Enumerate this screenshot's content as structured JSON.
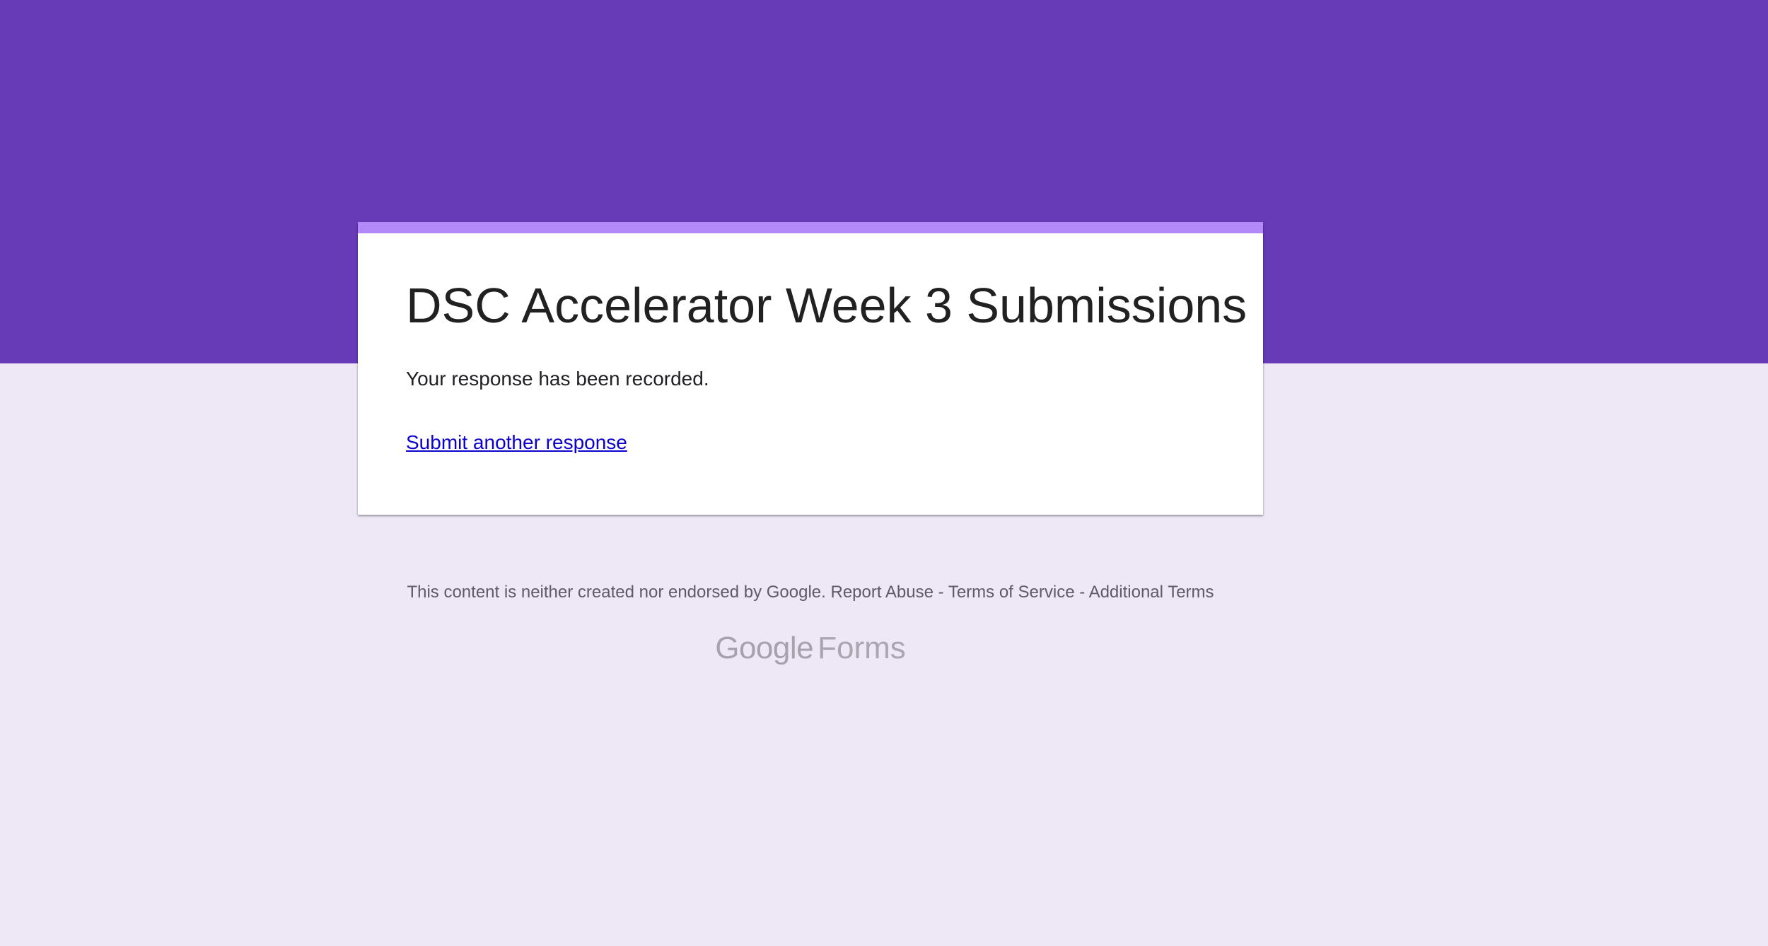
{
  "colors": {
    "header_band": "#673ab7",
    "page_background": "#ede7f6",
    "card_accent": "#b388f9",
    "link": "#0b00cc"
  },
  "form": {
    "title": "DSC Accelerator Week 3 Submissions",
    "confirmation": "Your response has been recorded.",
    "submit_another_label": "Submit another response"
  },
  "footer": {
    "disclaimer": "This content is neither created nor endorsed by Google.",
    "report_abuse": "Report Abuse",
    "separator": "-",
    "terms_of_service": "Terms of Service",
    "additional_terms": "Additional Terms"
  },
  "brand": {
    "google": "Google",
    "product": "Forms"
  }
}
